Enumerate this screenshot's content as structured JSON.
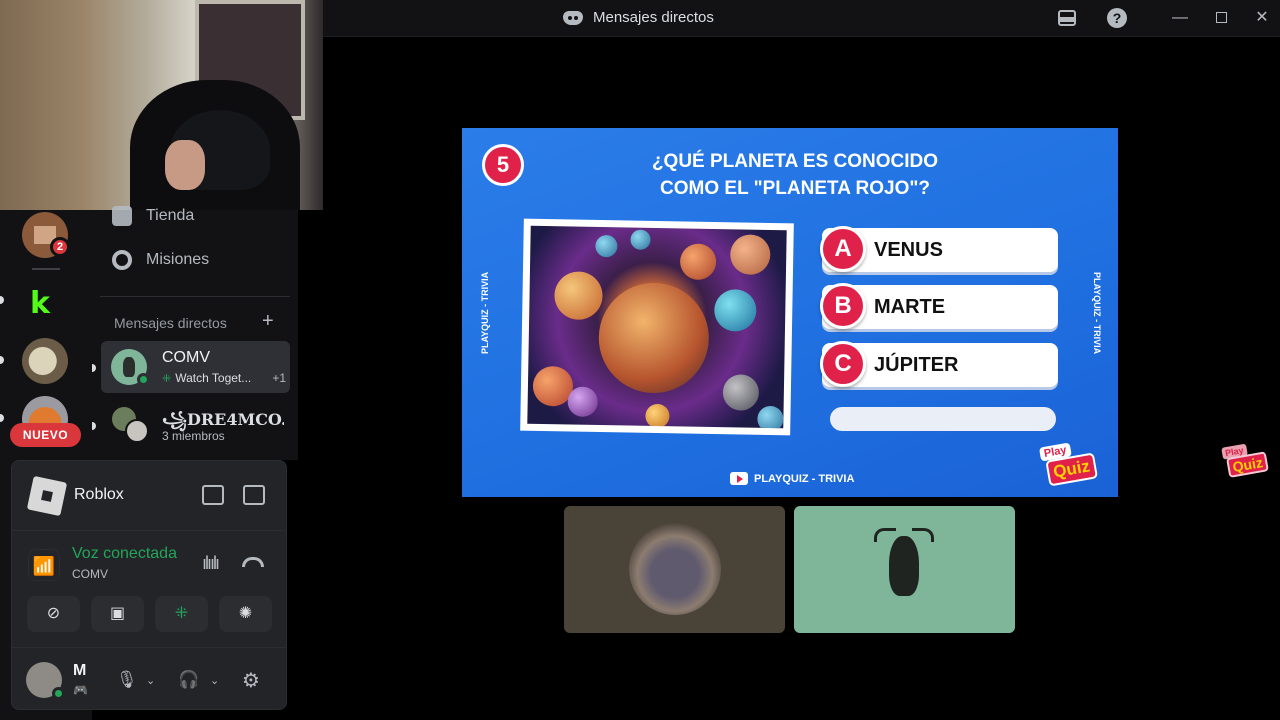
{
  "titlebar": {
    "title": "Mensajes directos",
    "icons": [
      "discord-logo-icon",
      "inbox-icon",
      "help-icon",
      "minimize-icon",
      "maximize-icon",
      "close-icon"
    ],
    "help_glyph": "?",
    "min_glyph": "—",
    "close_glyph": "✕"
  },
  "guilds": {
    "notification_count": "2",
    "new_label": "NUEVO",
    "kick_letter": "k"
  },
  "channels": {
    "nav": [
      {
        "label": "Tienda",
        "icon": "shop-icon"
      },
      {
        "label": "Misiones",
        "icon": "quests-icon"
      }
    ],
    "dm_header": "Mensajes directos",
    "dm_add": "+",
    "dms": [
      {
        "name": "COMV",
        "activity": "Watch Toget...",
        "extra": "+1",
        "activity_icon": "activity-icon"
      },
      {
        "name": "꧁DRE4MCO...",
        "members": "3 miembros"
      }
    ]
  },
  "panel": {
    "game": "Roblox",
    "voice_status": "Voz conectada",
    "voice_channel": "COMV",
    "user_name": "M",
    "buttons": [
      "video-off-icon",
      "screen-share-icon",
      "activities-icon",
      "soundboard-icon"
    ],
    "glyphs": {
      "voice": "📶",
      "wave": "ılıılı",
      "video_off": "⊘",
      "screen": "▣",
      "activity": "⁜",
      "sound": "✺",
      "game": "🎮",
      "mic": "🎙",
      "chev": "⌄",
      "headphones": "🎧",
      "gear": "⚙"
    }
  },
  "stream": {
    "number": "5",
    "question_line1": "¿QUÉ PLANETA ES CONOCIDO",
    "question_line2": "COMO EL \"PLANETA ROJO\"?",
    "side_label": "PLAYQUIZ - TRIVIA",
    "answers": [
      {
        "letter": "A",
        "text": "VENUS"
      },
      {
        "letter": "B",
        "text": "MARTE"
      },
      {
        "letter": "C",
        "text": "JÚPITER"
      }
    ],
    "footer": "PLAYQUIZ - TRIVIA",
    "logo_top": "Play",
    "logo_bottom": "Quiz"
  },
  "colors": {
    "discord_bg": "#121214",
    "quiz_blue": "#2b7de9",
    "quiz_red": "#e0224a",
    "online_green": "#23a55a",
    "mention_red": "#da373c"
  }
}
